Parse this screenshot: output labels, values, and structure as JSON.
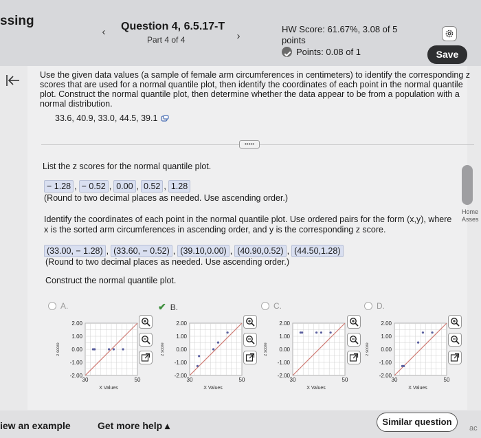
{
  "header": {
    "app_fragment": "ssing",
    "question_title": "Question 4, 6.5.17-T",
    "part": "Part 4 of 4",
    "hw_score": "HW Score: 61.67%, 3.08 of 5 points",
    "points": "Points: 0.08 of 1",
    "save_label": "Save",
    "prev_glyph": "‹",
    "next_glyph": "›"
  },
  "problem": {
    "prompt": "Use the given data values (a sample of female arm circumferences in centimeters) to identify the corresponding z scores that are used for a normal quantile plot, then identify the coordinates of each point in the normal quantile plot. Construct the normal quantile plot, then determine whether the data appear to be from a population with a normal distribution.",
    "data_values": "33.6, 40.9, 33.0, 44.5, 39.1",
    "more_label": "•••••"
  },
  "zscores": {
    "instruction": "List the z scores for the normal quantile plot.",
    "answers": [
      "− 1.28",
      "− 0.52",
      "0.00",
      "0.52",
      "1.28"
    ],
    "note": "(Round to two decimal places as needed. Use ascending order.)"
  },
  "coords": {
    "instruction": "Identify the coordinates of each point in the normal quantile plot. Use ordered pairs for the form (x,y), where x is the sorted arm circumferences in ascending order, and y is the corresponding z score.",
    "answers": [
      "(33.00, − 1.28)",
      "(33.60, − 0.52)",
      "(39.10,0.00)",
      "(40.90,0.52)",
      "(44.50,1.28)"
    ],
    "note": "(Round to two decimal places as needed. Use ascending order.)"
  },
  "construct": {
    "instruction": "Construct the normal quantile plot.",
    "options": [
      {
        "label": "A."
      },
      {
        "label": "B.",
        "selected": true
      },
      {
        "label": "C."
      },
      {
        "label": "D."
      }
    ],
    "plot_labels": {
      "ylabel": "z score",
      "xlabel": "X Values",
      "yticks": [
        "2.00",
        "1.00",
        "0.00",
        "-1.00",
        "-2.00"
      ],
      "xticks": [
        "30",
        "50"
      ]
    }
  },
  "chart_data": [
    {
      "type": "scatter",
      "xlim": [
        30,
        50
      ],
      "ylim": [
        -2,
        2
      ],
      "x": [
        33.0,
        33.6,
        39.1,
        40.9,
        44.5
      ],
      "y": [
        0.0,
        0.0,
        0.0,
        0.0,
        0.0
      ],
      "grid": true
    },
    {
      "type": "scatter",
      "xlim": [
        30,
        50
      ],
      "ylim": [
        -2,
        2
      ],
      "x": [
        33.0,
        33.6,
        39.1,
        40.9,
        44.5
      ],
      "y": [
        -1.28,
        -0.52,
        0.0,
        0.52,
        1.28
      ],
      "grid": true
    },
    {
      "type": "scatter",
      "xlim": [
        30,
        50
      ],
      "ylim": [
        -2,
        2
      ],
      "x": [
        33.0,
        33.6,
        39.1,
        40.9,
        44.5
      ],
      "y": [
        1.28,
        1.28,
        1.28,
        1.28,
        1.28
      ],
      "grid": true
    },
    {
      "type": "scatter",
      "xlim": [
        30,
        50
      ],
      "ylim": [
        -2,
        2
      ],
      "x": [
        33.0,
        33.6,
        39.1,
        40.9,
        44.5
      ],
      "y": [
        -1.28,
        -1.28,
        0.52,
        1.28,
        1.28
      ],
      "grid": true
    }
  ],
  "side": {
    "home_label": "Home",
    "assess_label": "Asses"
  },
  "footer": {
    "example": "iew an example",
    "help": "Get more help ▴",
    "similar": "Similar question",
    "ac": "ac"
  },
  "colors": {
    "answer_bg": "#d9dff0",
    "plot_line": "#cf7b74",
    "plot_point": "#5a5f9e",
    "check": "#3d8f3d"
  }
}
